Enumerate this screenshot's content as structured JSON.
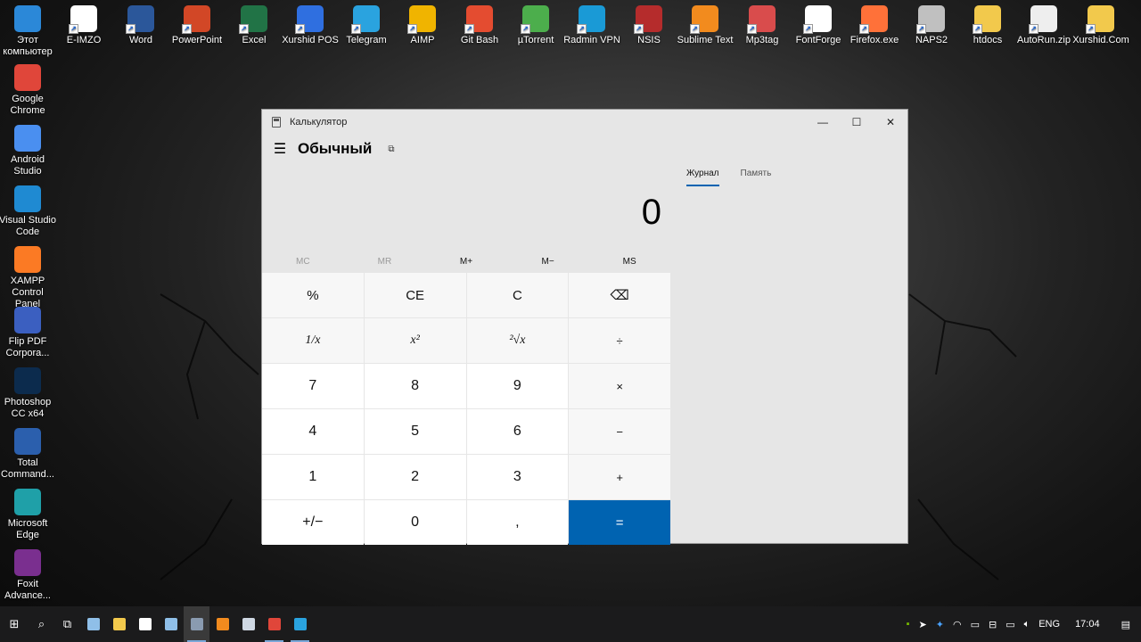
{
  "desktop": {
    "top_icons": [
      {
        "label": "Этот компьютер",
        "icon": "this-pc-icon",
        "color": "#2b88d8"
      },
      {
        "label": "E-IMZO",
        "icon": "e-imzo-icon",
        "color": "#ffffff"
      },
      {
        "label": "Word",
        "icon": "word-icon",
        "color": "#2b579a"
      },
      {
        "label": "PowerPoint",
        "icon": "powerpoint-icon",
        "color": "#d24726"
      },
      {
        "label": "Excel",
        "icon": "excel-icon",
        "color": "#217346"
      },
      {
        "label": "Xurshid POS",
        "icon": "xurshid-pos-icon",
        "color": "#2f6fe0"
      },
      {
        "label": "Telegram",
        "icon": "telegram-icon",
        "color": "#2aa3df"
      },
      {
        "label": "AIMP",
        "icon": "aimp-icon",
        "color": "#f0b400"
      },
      {
        "label": "Git Bash",
        "icon": "git-bash-icon",
        "color": "#e44c30"
      },
      {
        "label": "µTorrent",
        "icon": "utorrent-icon",
        "color": "#4cae4c"
      },
      {
        "label": "Radmin VPN",
        "icon": "radmin-vpn-icon",
        "color": "#1a9ad6"
      },
      {
        "label": "NSIS",
        "icon": "nsis-icon",
        "color": "#b52c2c"
      },
      {
        "label": "Sublime Text",
        "icon": "sublime-text-icon",
        "color": "#f28b1e"
      },
      {
        "label": "Mp3tag",
        "icon": "mp3tag-icon",
        "color": "#d94c4c"
      },
      {
        "label": "FontForge",
        "icon": "fontforge-icon",
        "color": "#ffffff"
      },
      {
        "label": "Firefox.exe",
        "icon": "firefox-icon",
        "color": "#ff7139"
      },
      {
        "label": "NAPS2",
        "icon": "naps2-icon",
        "color": "#c0c0c0"
      },
      {
        "label": "htdocs",
        "icon": "folder-icon",
        "color": "#f2c94c"
      },
      {
        "label": "AutoRun.zip",
        "icon": "7z-archive-icon",
        "color": "#eeeeee"
      },
      {
        "label": "Xurshid.Com",
        "icon": "xurshid-com-icon",
        "color": "#f2c94c"
      }
    ],
    "left_icons": [
      {
        "label": "Google Chrome",
        "icon": "chrome-icon",
        "color": "#e0463a"
      },
      {
        "label": "Android Studio",
        "icon": "android-studio-icon",
        "color": "#4a8ff0"
      },
      {
        "label": "Visual Studio Code",
        "icon": "vscode-icon",
        "color": "#1f8ad2"
      },
      {
        "label": "XAMPP Control Panel",
        "icon": "xampp-icon",
        "color": "#fb7a24"
      },
      {
        "label": "Flip PDF Corpora...",
        "icon": "flip-pdf-icon",
        "color": "#3b5fc0"
      },
      {
        "label": "Photoshop CC x64",
        "icon": "photoshop-icon",
        "color": "#0c2b4d"
      },
      {
        "label": "Total Command...",
        "icon": "total-commander-icon",
        "color": "#2b5fad"
      },
      {
        "label": "Microsoft Edge",
        "icon": "edge-icon",
        "color": "#1fa0a8"
      },
      {
        "label": "Foxit Advance...",
        "icon": "foxit-icon",
        "color": "#7a2f8f"
      }
    ]
  },
  "calculator": {
    "window_title": "Калькулятор",
    "mode_title": "Обычный",
    "display_value": "0",
    "memory_buttons": [
      {
        "label": "MC",
        "enabled": false
      },
      {
        "label": "MR",
        "enabled": false
      },
      {
        "label": "M+",
        "enabled": true
      },
      {
        "label": "M−",
        "enabled": true
      },
      {
        "label": "MS",
        "enabled": true
      }
    ],
    "keys": [
      {
        "label": "%",
        "kind": "fn",
        "name": "percent-button"
      },
      {
        "label": "CE",
        "kind": "fn",
        "name": "clear-entry-button"
      },
      {
        "label": "C",
        "kind": "fn",
        "name": "clear-button"
      },
      {
        "label": "⌫",
        "kind": "fn",
        "name": "backspace-button"
      },
      {
        "label": "1/x",
        "kind": "it",
        "name": "reciprocal-button"
      },
      {
        "label": "x²",
        "kind": "it",
        "name": "square-button"
      },
      {
        "label": "²√x",
        "kind": "it",
        "name": "square-root-button"
      },
      {
        "label": "÷",
        "kind": "op",
        "name": "divide-button"
      },
      {
        "label": "7",
        "kind": "num",
        "name": "digit-7-button"
      },
      {
        "label": "8",
        "kind": "num",
        "name": "digit-8-button"
      },
      {
        "label": "9",
        "kind": "num",
        "name": "digit-9-button"
      },
      {
        "label": "×",
        "kind": "op",
        "name": "multiply-button"
      },
      {
        "label": "4",
        "kind": "num",
        "name": "digit-4-button"
      },
      {
        "label": "5",
        "kind": "num",
        "name": "digit-5-button"
      },
      {
        "label": "6",
        "kind": "num",
        "name": "digit-6-button"
      },
      {
        "label": "−",
        "kind": "op",
        "name": "minus-button"
      },
      {
        "label": "1",
        "kind": "num",
        "name": "digit-1-button"
      },
      {
        "label": "2",
        "kind": "num",
        "name": "digit-2-button"
      },
      {
        "label": "3",
        "kind": "num",
        "name": "digit-3-button"
      },
      {
        "label": "+",
        "kind": "op",
        "name": "plus-button"
      },
      {
        "label": "+/−",
        "kind": "num",
        "name": "negate-button"
      },
      {
        "label": "0",
        "kind": "num",
        "name": "digit-0-button"
      },
      {
        "label": ",",
        "kind": "num",
        "name": "decimal-button"
      },
      {
        "label": "=",
        "kind": "eq",
        "name": "equals-button"
      }
    ],
    "side_tabs": [
      {
        "label": "Журнал",
        "active": true
      },
      {
        "label": "Память",
        "active": false
      }
    ],
    "accent_color": "#0063b1"
  },
  "taskbar": {
    "pinned": [
      {
        "name": "start-button",
        "glyph": "⊞",
        "color": "",
        "running": false,
        "active": false
      },
      {
        "name": "search-icon",
        "glyph": "⌕",
        "color": "",
        "running": false,
        "active": false
      },
      {
        "name": "task-view-icon",
        "glyph": "⧉",
        "color": "",
        "running": false,
        "active": false
      },
      {
        "name": "app-icon",
        "glyph": "",
        "color": "#8fbfe8",
        "running": false,
        "active": false
      },
      {
        "name": "file-explorer-icon",
        "glyph": "",
        "color": "#f2c94c",
        "running": false,
        "active": false
      },
      {
        "name": "security-icon",
        "glyph": "",
        "color": "#ffffff",
        "running": false,
        "active": false
      },
      {
        "name": "app-icon",
        "glyph": "",
        "color": "#8fbfe8",
        "running": false,
        "active": false
      },
      {
        "name": "calculator-task-icon",
        "glyph": "",
        "color": "#8a9bb0",
        "running": true,
        "active": true
      },
      {
        "name": "sublime-text-task-icon",
        "glyph": "",
        "color": "#f28b1e",
        "running": false,
        "active": false
      },
      {
        "name": "notes-task-icon",
        "glyph": "",
        "color": "#cfd8e3",
        "running": false,
        "active": false
      },
      {
        "name": "chrome-task-icon",
        "glyph": "",
        "color": "#e0463a",
        "running": true,
        "active": false
      },
      {
        "name": "telegram-task-icon",
        "glyph": "",
        "color": "#2aa3df",
        "running": true,
        "active": false
      }
    ],
    "language": "ENG",
    "time": "17:04"
  }
}
